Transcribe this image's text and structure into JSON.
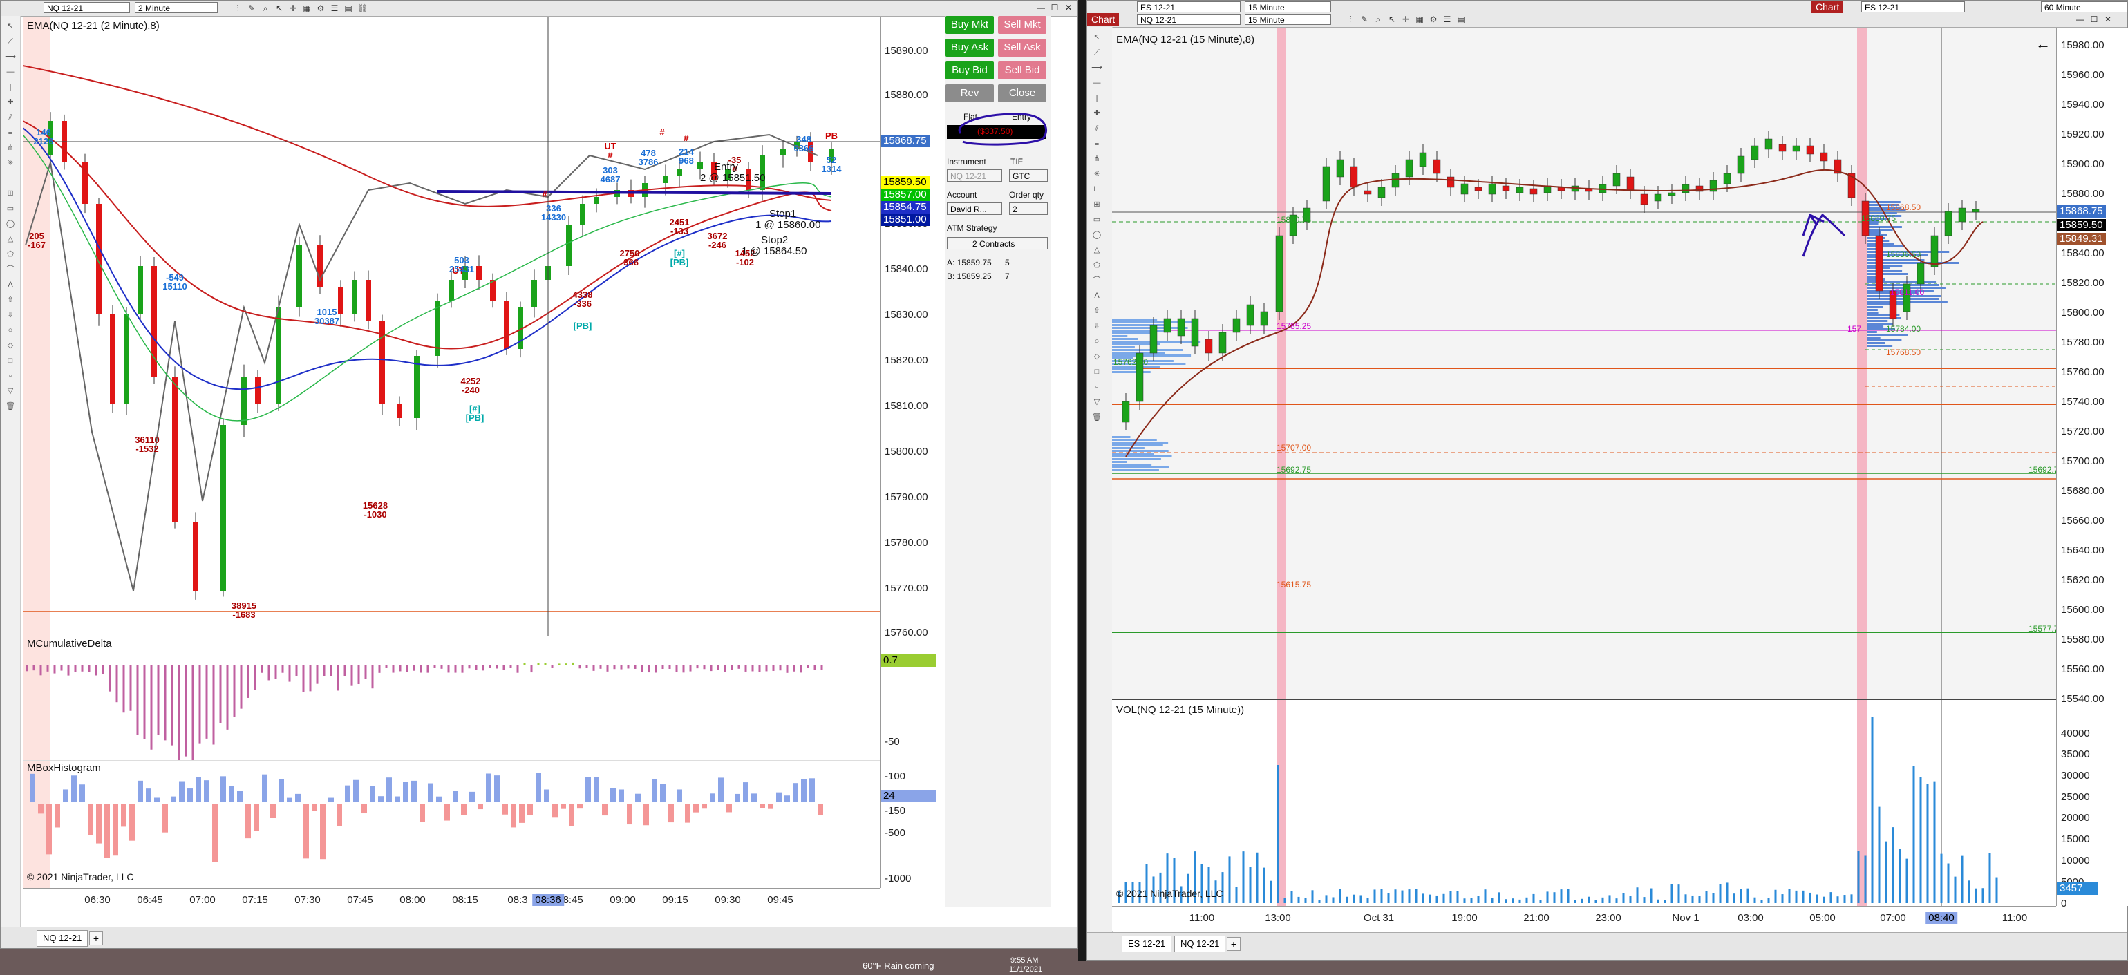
{
  "left": {
    "toolbar": {
      "instrument": "NQ 12-21",
      "interval": "2 Minute",
      "chart_label": "Chart"
    },
    "price_panel": {
      "title": "EMA(NQ 12-21 (2 Minute),8)",
      "y_ticks": [
        "15890.00",
        "15880.00",
        "15870.00",
        "15850.00",
        "15840.00",
        "15830.00",
        "15820.00",
        "15810.00",
        "15800.00",
        "15790.00",
        "15780.00",
        "15770.00",
        "15760.00"
      ],
      "price_tags": {
        "last": "15859.50",
        "blue1": "15854.75",
        "blue2": "15851.00",
        "crosshair": "15868.75",
        "hidden": "15857.00"
      }
    },
    "delta_panel": {
      "title": "MCumulativeDelta",
      "y_ticks": [
        "-50",
        "-100",
        "-150"
      ],
      "value": "0.7"
    },
    "box_panel": {
      "title": "MBoxHistogram",
      "y_ticks": [
        "-500",
        "-1000"
      ],
      "value": "24"
    },
    "x_ticks": [
      "06:30",
      "06:45",
      "07:00",
      "07:15",
      "07:30",
      "07:45",
      "08:00",
      "08:15",
      "08:3",
      "08:45",
      "09:00",
      "09:15",
      "09:30",
      "09:45"
    ],
    "x_cursor": "08:36",
    "copyright": "© 2021 NinjaTrader, LLC",
    "tab": "NQ 12-21",
    "annotations": [
      {
        "v": "146",
        "l": "2126",
        "c": "#1a6fd6"
      },
      {
        "v": "205",
        "l": "-167",
        "c": "#a00"
      },
      {
        "v": "-549",
        "l": "15110",
        "c": "#1a6fd6"
      },
      {
        "v": "36110",
        "l": "-1532",
        "c": "#a00"
      },
      {
        "v": "38915",
        "l": "-1683",
        "c": "#a00"
      },
      {
        "v": "1015",
        "l": "30387",
        "c": "#1a6fd6"
      },
      {
        "v": "15628",
        "l": "-1030",
        "c": "#a00"
      },
      {
        "v": "UT",
        "l": "",
        "c": "#c00"
      },
      {
        "v": "503",
        "l": "25431",
        "c": "#1a6fd6"
      },
      {
        "v": "4252",
        "l": "-240",
        "c": "#a00"
      },
      {
        "v": "[#]",
        "l": "[PB]",
        "c": "#0aa"
      },
      {
        "v": "#",
        "l": "",
        "c": "#c00"
      },
      {
        "v": "336",
        "l": "14330",
        "c": "#1a6fd6"
      },
      {
        "v": "UT",
        "l": "#",
        "c": "#c00"
      },
      {
        "v": "303",
        "l": "4687",
        "c": "#1a6fd6"
      },
      {
        "v": "4338",
        "l": "-336",
        "c": "#a00"
      },
      {
        "v": "[PB]",
        "l": "",
        "c": "#0aa"
      },
      {
        "v": "2750",
        "l": "-366",
        "c": "#a00"
      },
      {
        "v": "#",
        "l": "",
        "c": "#c00"
      },
      {
        "v": "478",
        "l": "3786",
        "c": "#1a6fd6"
      },
      {
        "v": "#",
        "l": "",
        "c": "#c00"
      },
      {
        "v": "214",
        "l": "968",
        "c": "#1a6fd6"
      },
      {
        "v": "2451",
        "l": "-133",
        "c": "#a00"
      },
      {
        "v": "[#]",
        "l": "[PB]",
        "c": "#0aa"
      },
      {
        "v": "3672",
        "l": "-246",
        "c": "#a00"
      },
      {
        "v": "-35",
        "l": "#",
        "c": "#a00"
      },
      {
        "v": "1452",
        "l": "-102",
        "c": "#a00"
      },
      {
        "v": "348",
        "l": "6366",
        "c": "#1a6fd6"
      },
      {
        "v": "PB",
        "l": "",
        "c": "#c00"
      },
      {
        "v": "52",
        "l": "1314",
        "c": "#1a6fd6"
      }
    ],
    "orders": {
      "entry": "Entry",
      "entry_qty": "2 @ 15851.50",
      "stop1": "Stop1",
      "stop1_qty": "1 @ 15860.00",
      "stop2": "Stop2",
      "stop2_qty": "1 @ 15864.50",
      "num": "2"
    }
  },
  "trade_panel": {
    "buy_mkt": "Buy Mkt",
    "sell_mkt": "Sell Mkt",
    "buy_ask": "Buy Ask",
    "sell_ask": "Sell Ask",
    "buy_bid": "Buy Bid",
    "sell_bid": "Sell Bid",
    "rev": "Rev",
    "close": "Close",
    "flat": "Flat",
    "entry": "Entry",
    "pnl": "($337.50)",
    "instrument_label": "Instrument",
    "instrument_value": "NQ 12-21",
    "tif_label": "TIF",
    "tif_value": "GTC",
    "account_label": "Account",
    "account_value": "David R...",
    "qty_label": "Order qty",
    "qty_value": "2",
    "atm_label": "ATM Strategy",
    "atm_value": "2 Contracts",
    "ask": "A: 15859.75",
    "ask_qty": "5",
    "bid": "B: 15859.25",
    "bid_qty": "7"
  },
  "right": {
    "toolbar": {
      "chart_label": "Chart",
      "instrument": "NQ 12-21",
      "interval": "15 Minute",
      "instrument2": "ES 12-21",
      "interval2": "15 Minute",
      "instrument3": "ES 12-21",
      "interval3": "60 Minute"
    },
    "price_panel": {
      "title": "EMA(NQ 12-21 (15 Minute),8)",
      "y_ticks": [
        "15980.00",
        "15960.00",
        "15940.00",
        "15920.00",
        "15900.00",
        "15880.00",
        "15840.00",
        "15820.00",
        "15800.00",
        "15780.00",
        "15760.00",
        "15740.00",
        "15720.00",
        "15700.00",
        "15680.00",
        "15660.00",
        "15640.00",
        "15620.00",
        "15600.00",
        "15580.00",
        "15560.00",
        "15540.00"
      ],
      "price_tags": {
        "crosshair": "15868.75",
        "last": "15859.50",
        "ema": "15849.31"
      }
    },
    "levels": [
      {
        "t": "15868.50",
        "c": "#e0561a"
      },
      {
        "t": "15860.75",
        "c": "#2a9a2a"
      },
      {
        "t": "15860.75",
        "c": "#2a9a2a"
      },
      {
        "t": "15836.50",
        "c": "#2a9a2a"
      },
      {
        "t": "15811.00",
        "c": "#cc00cc"
      },
      {
        "t": "15785.25",
        "c": "#cc00cc"
      },
      {
        "t": "15784.00",
        "c": "#2a9a2a"
      },
      {
        "t": "15768.50",
        "c": "#e0561a"
      },
      {
        "t": "15762.50",
        "c": "#2a9a2a"
      },
      {
        "t": "15707.00",
        "c": "#e0561a"
      },
      {
        "t": "15692.75",
        "c": "#2a9a2a"
      },
      {
        "t": "15692.75",
        "c": "#2a9a2a"
      },
      {
        "t": "15615.75",
        "c": "#e0561a"
      },
      {
        "t": "15577.75",
        "c": "#2a9a2a"
      },
      {
        "t": "157",
        "c": "#cc00cc"
      }
    ],
    "vol_panel": {
      "title": "VOL(NQ 12-21 (15 Minute))",
      "y_ticks": [
        "40000",
        "35000",
        "30000",
        "25000",
        "20000",
        "15000",
        "10000",
        "5000",
        "0"
      ],
      "value": "3457"
    },
    "x_ticks": [
      "11:00",
      "13:00",
      "Oct 31",
      "19:00",
      "21:00",
      "23:00",
      "Nov 1",
      "03:00",
      "05:00",
      "07:00",
      "11:00"
    ],
    "x_cursor": "08:40",
    "copyright": "© 2021 NinjaTrader, LLC",
    "tabs": [
      "ES 12-21",
      "NQ 12-21"
    ]
  },
  "taskbar": {
    "weather": "60°F Rain coming",
    "time": "9:55 AM",
    "date": "11/1/2021"
  },
  "colors": {
    "buy": "#1aa31a",
    "sell": "#e27a8f",
    "up_candle": "#1aa31a",
    "down_candle": "#e01515",
    "ema_red": "#c81e1e",
    "ema_blue": "#1e2fc8",
    "volume": "#2a8ad8"
  }
}
